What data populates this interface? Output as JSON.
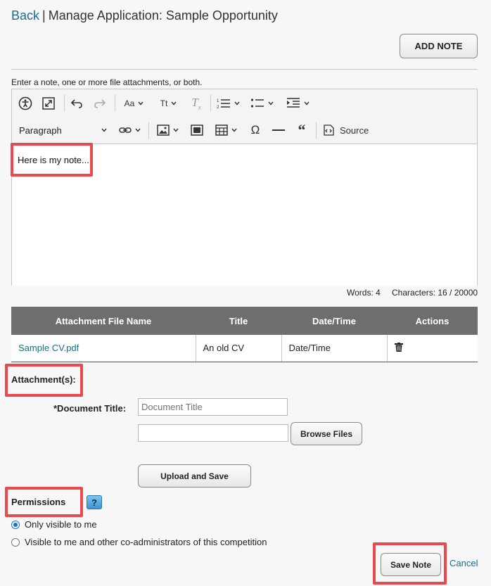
{
  "header": {
    "back": "Back",
    "separator": "|",
    "title": "Manage Application: Sample Opportunity"
  },
  "add_note_label": "ADD NOTE",
  "instructions": "Enter a note, one or more file attachments, or both.",
  "editor": {
    "paragraph": "Paragraph",
    "source": "Source",
    "text": "Here is my note...",
    "words": "Words: 4",
    "characters": "Characters: 16 / 20000"
  },
  "attachments_table": {
    "headers": [
      "Attachment File Name",
      "Title",
      "Date/Time",
      "Actions"
    ],
    "rows": [
      {
        "file": "Sample CV.pdf",
        "title": "An old CV",
        "datetime": "Date/Time"
      }
    ]
  },
  "attachments": {
    "label": "Attachment(s):",
    "doc_title_label": "*Document Title:",
    "doc_title_placeholder": "Document Title",
    "browse_label": "Browse Files",
    "upload_label": "Upload and Save"
  },
  "permissions": {
    "label": "Permissions",
    "help": "?",
    "options": [
      {
        "label": "Only visible to me",
        "selected": true
      },
      {
        "label": "Visible to me and other co-administrators of this competition",
        "selected": false
      }
    ]
  },
  "footer": {
    "save_label": "Save Note",
    "cancel_label": "Cancel"
  },
  "colors": {
    "link": "#1a6e8a",
    "highlight": "#e84a4f",
    "table_header": "#6e6e6e"
  }
}
